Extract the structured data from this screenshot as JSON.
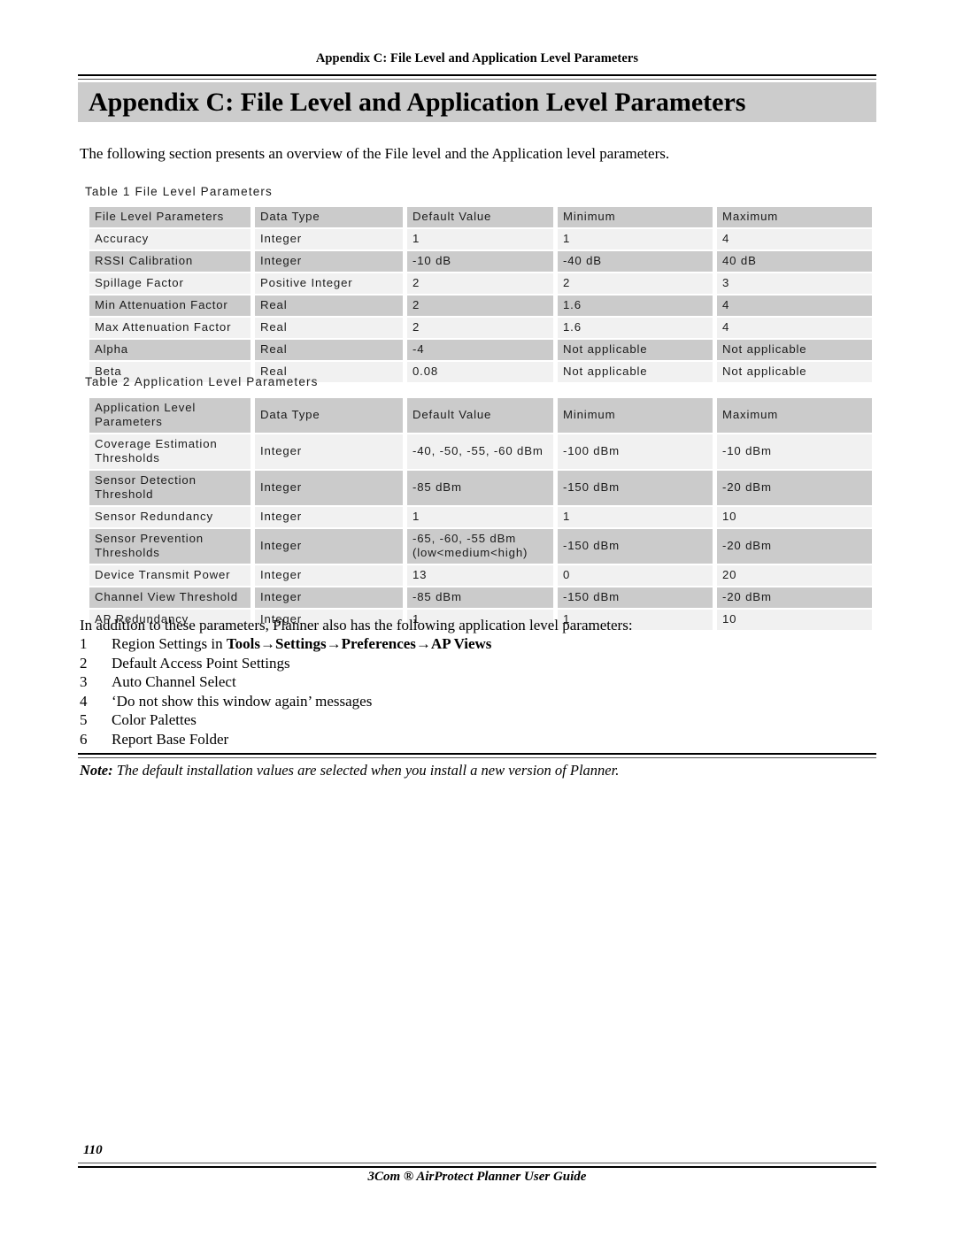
{
  "header": {
    "running_header": "Appendix C: File Level and Application Level Parameters",
    "chapter_title": "Appendix C: File Level and Application Level Parameters"
  },
  "intro_paragraph": "The following section presents an overview of the File level and the Application level parameters.",
  "table1": {
    "caption": "Table 1 File Level Parameters",
    "columns": [
      "File Level Parameters",
      "Data Type",
      "Default Value",
      "Minimum",
      "Maximum"
    ],
    "rows": [
      [
        "Accuracy",
        "Integer",
        "1",
        "1",
        "4"
      ],
      [
        "RSSI Calibration",
        "Integer",
        "-10 dB",
        "-40 dB",
        "40 dB"
      ],
      [
        "Spillage Factor",
        "Positive Integer",
        "2",
        "2",
        "3"
      ],
      [
        "Min Attenuation Factor",
        "Real",
        "2",
        "1.6",
        "4"
      ],
      [
        "Max Attenuation Factor",
        "Real",
        "2",
        "1.6",
        "4"
      ],
      [
        "Alpha",
        "Real",
        "-4",
        "Not applicable",
        "Not applicable"
      ],
      [
        "Beta",
        "Real",
        "0.08",
        "Not applicable",
        "Not applicable"
      ]
    ]
  },
  "table2": {
    "caption": "Table 2 Application Level Parameters",
    "columns": [
      "Application Level Parameters",
      "Data Type",
      "Default Value",
      "Minimum",
      "Maximum"
    ],
    "rows": [
      [
        "Coverage Estimation Thresholds",
        "Integer",
        "-40, -50, -55, -60 dBm",
        "-100 dBm",
        "-10 dBm"
      ],
      [
        "Sensor Detection Threshold",
        "Integer",
        "-85 dBm",
        "-150 dBm",
        "-20 dBm"
      ],
      [
        "Sensor Redundancy",
        "Integer",
        "1",
        "1",
        "10"
      ],
      [
        "Sensor Prevention Thresholds",
        "Integer",
        "-65, -60, -55 dBm (low<medium<high)",
        "-150 dBm",
        "-20 dBm"
      ],
      [
        "Device Transmit Power",
        "Integer",
        "13",
        "0",
        "20"
      ],
      [
        "Channel View Threshold",
        "Integer",
        "-85 dBm",
        "-150 dBm",
        "-20 dBm"
      ],
      [
        "AP Redundancy",
        "Integer",
        "1",
        "1",
        "10"
      ]
    ]
  },
  "list_intro": "In addition to these parameters, Planner also has the following application level parameters:",
  "list": {
    "items": [
      {
        "num": "1",
        "text_plain": "Region Settings in ",
        "text_bold": "Tools→Settings→Preferences→AP Views"
      },
      {
        "num": "2",
        "text_plain": "Default Access Point Settings",
        "text_bold": ""
      },
      {
        "num": "3",
        "text_plain": "Auto Channel Select",
        "text_bold": ""
      },
      {
        "num": "4",
        "text_plain": "‘Do not show this window again’ messages",
        "text_bold": ""
      },
      {
        "num": "5",
        "text_plain": "Color Palettes",
        "text_bold": ""
      },
      {
        "num": "6",
        "text_plain": "Report Base Folder",
        "text_bold": ""
      }
    ]
  },
  "note": {
    "label": "Note:",
    "text": " The default installation values are selected when you install a new version of Planner."
  },
  "footer": {
    "page_number": "110",
    "guide_title": "3Com ® AirProtect Planner User Guide"
  },
  "colors": {
    "band_gray": "#cccccc",
    "header_row_gray": "#cbcbcb",
    "light_row_gray": "#f1f1f1",
    "rule_black": "#000000"
  }
}
